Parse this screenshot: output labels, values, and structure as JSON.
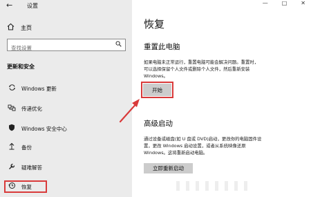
{
  "window": {
    "back": "←",
    "title": "设置",
    "minimize": "—",
    "maximize": "□",
    "close": "✕"
  },
  "sidebar": {
    "home_label": "主页",
    "search_placeholder": "查找设置",
    "section_title": "更新和安全",
    "items": [
      {
        "label": "Windows 更新",
        "icon": "sync-icon"
      },
      {
        "label": "传递优化",
        "icon": "delivery-optimization-icon"
      },
      {
        "label": "Windows 安全中心",
        "icon": "shield-icon"
      },
      {
        "label": "备份",
        "icon": "backup-icon"
      },
      {
        "label": "疑难解答",
        "icon": "wrench-icon"
      },
      {
        "label": "恢复",
        "icon": "recovery-icon",
        "selected": true
      }
    ]
  },
  "main": {
    "title": "恢复",
    "reset": {
      "heading": "重置此电脑",
      "desc_line1": "如果电脑未正常运行，重置电脑可能会解决问题。重置时，",
      "desc_line2": "可以选择保留个人文件或删除个人文件，然后重新安装",
      "desc_line3": "Windows。",
      "button": "开始"
    },
    "advanced": {
      "heading": "高级启动",
      "desc_line1": "通过设备或磁盘(如 U 盘或 DVD)启动，更改你的电脑固件设",
      "desc_line2": "置，更改 Windows 启动设置，或者从系统映像还原",
      "desc_line3": "Windows。这将重新启动电脑。",
      "button": "立即重新启动"
    }
  },
  "colors": {
    "highlight": "#d93a3a",
    "sidebar_bg": "#ebebeb",
    "button_bg": "#cccccc"
  }
}
